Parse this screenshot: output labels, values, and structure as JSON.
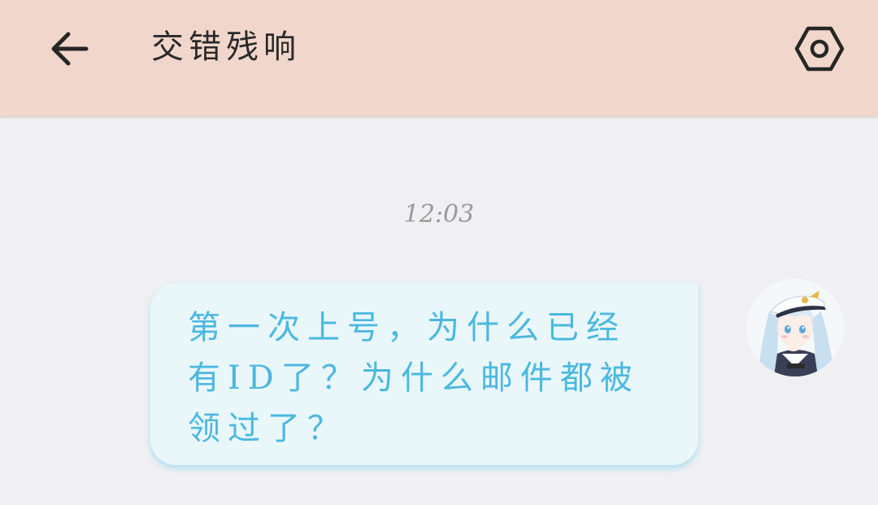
{
  "header": {
    "title": "交错残响",
    "back_icon": "arrow-left-icon",
    "settings_icon": "hexagon-settings-icon",
    "background_color": "#f1d7cb"
  },
  "conversation": {
    "timestamp": "12:03",
    "messages": [
      {
        "sender": "self",
        "text": "第一次上号，为什么已经有ID了？为什么邮件都被领过了？",
        "avatar_icon": "anime-girl-avatar"
      }
    ]
  },
  "colors": {
    "page_background": "#f0f0f2",
    "bubble_background": "#e9f7fb",
    "bubble_text": "#4bb8e0",
    "timestamp_text": "#9a9a9a"
  }
}
